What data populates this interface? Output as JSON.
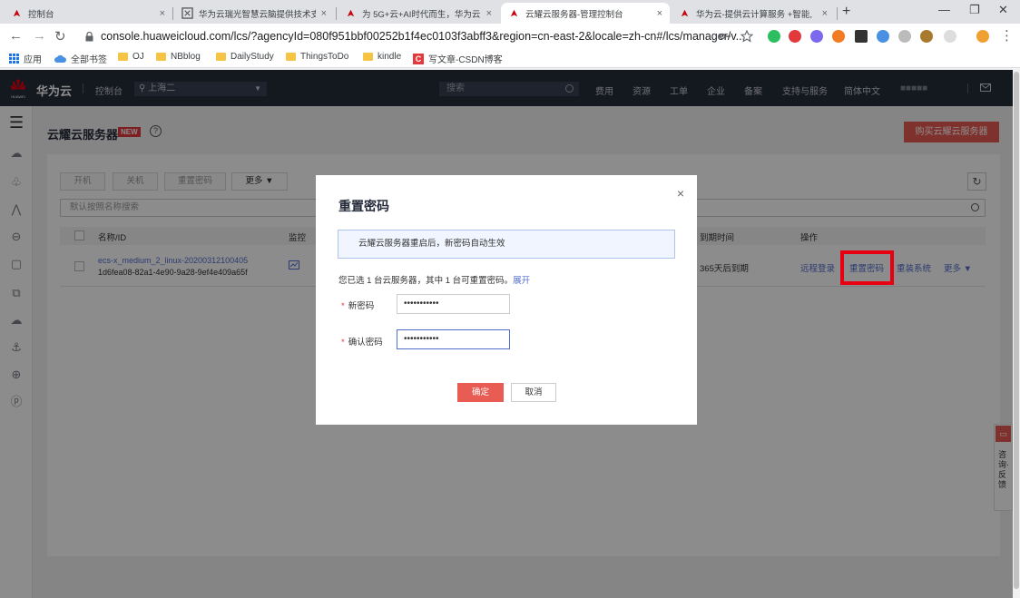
{
  "browser": {
    "tabs": [
      {
        "title": "控制台",
        "close": "×"
      },
      {
        "title": "华为云瑞光智慧云脑提供技术支持",
        "close": "×"
      },
      {
        "title": "为 5G+云+AI时代而生，华为云",
        "close": "×"
      },
      {
        "title": "云耀云服务器-管理控制台",
        "close": "×"
      },
      {
        "title": "华为云-提供云计算服务 +智能,",
        "close": "×"
      }
    ],
    "new_tab": "+",
    "window_controls": {
      "minimize": "—",
      "maximize": "❐",
      "close": "✕"
    },
    "nav": {
      "back": "←",
      "forward": "→",
      "reload": "↻"
    },
    "url": "console.huaweicloud.com/lcs/?agencyId=080f951bbf00252b1f4ec0103f3abff3&region=cn-east-2&locale=zh-cn#/lcs/manager/v...",
    "bookmarks": [
      "应用",
      "全部书签",
      "OJ",
      "NBblog",
      "DailyStudy",
      "ThingsToDo",
      "kindle",
      "写文章-CSDN博客"
    ]
  },
  "console": {
    "brand": "华为云",
    "brand_logo_text": "HUAWEI",
    "nav_console": "控制台",
    "region": "上海二",
    "search_placeholder": "搜索",
    "menu": [
      "费用",
      "资源",
      "工单",
      "企业",
      "备案",
      "支持与服务",
      "简体中文"
    ],
    "username": "■■■■■"
  },
  "page": {
    "title": "云耀云服务器",
    "badge": "NEW",
    "help": "?",
    "buy_button": "购买云耀云服务器",
    "toolbar": {
      "start": "开机",
      "stop": "关机",
      "reset_pwd": "重置密码",
      "more": "更多 ▼"
    },
    "filter_placeholder": "默认按照名称搜索",
    "columns": {
      "name": "名称/ID",
      "monitor": "监控",
      "expire": "到期时间",
      "ops": "操作"
    },
    "row": {
      "name": "ecs-x_medium_2_linux-20200312100405",
      "id": "1d6fea08-82a1-4e90-9a28-9ef4e409a65f",
      "expire": "365天后到期",
      "op_remote": "远程登录",
      "op_reset": "重置密码",
      "op_reinstall": "重装系统",
      "op_more": "更多 ▼"
    },
    "feedback": "咨询·反馈"
  },
  "modal": {
    "title": "重置密码",
    "close": "×",
    "notice": "云耀云服务器重启后，新密码自动生效",
    "selection_text": "您已选 1 台云服务器，其中 1 台可重置密码。",
    "expand_link": "展开",
    "new_password_label": "新密码",
    "confirm_password_label": "确认密码",
    "new_password_value": "•••••••••••",
    "confirm_password_value": "•••••••••••",
    "required_mark": "*",
    "ok": "确定",
    "cancel": "取消"
  },
  "colors": {
    "brand_red": "#e4393c",
    "nav_bg": "#262c3a",
    "link": "#526ecc",
    "primary_btn": "#e85c53",
    "highlight": "#e60012"
  }
}
